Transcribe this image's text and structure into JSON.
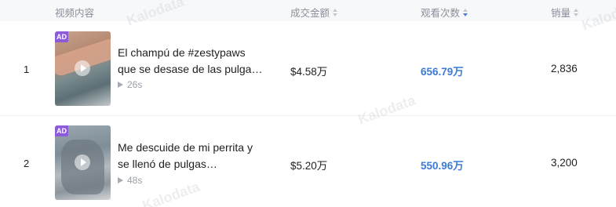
{
  "header": {
    "col_video": "视频内容",
    "col_gmv": "成交金额",
    "col_views": "观看次数",
    "col_sales": "销量"
  },
  "watermark_text": "Kalodata",
  "rows": [
    {
      "rank": "1",
      "badge": "AD",
      "title": "El champú de #zestypaws que se desase de las pulga…",
      "duration": "26s",
      "gmv": "$4.58万",
      "views": "656.79万",
      "sales": "2,836"
    },
    {
      "rank": "2",
      "badge": "AD",
      "title": "Me descuide de mi perrita y se llenó de pulgas…",
      "duration": "48s",
      "gmv": "$5.20万",
      "views": "550.96万",
      "sales": "3,200"
    }
  ],
  "colors": {
    "ad_badge": "#8c5bd9",
    "views_text": "#3d7bd6",
    "header_bg": "#f7f8fa"
  },
  "icons": {
    "sort": "sort-icon",
    "play": "play-icon",
    "duration": "play-triangle-icon"
  }
}
